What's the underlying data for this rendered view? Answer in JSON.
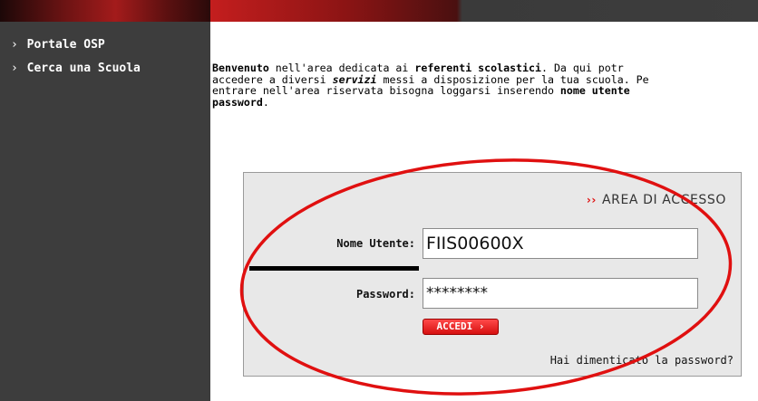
{
  "sidebar": {
    "items": [
      {
        "chevron": "›",
        "label": "Portale OSP"
      },
      {
        "chevron": "›",
        "label": "Cerca una Scuola"
      }
    ]
  },
  "intro": {
    "line1": {
      "w1": "Benvenuto",
      "t1": " nell'area dedicata ai ",
      "w2": "referenti scolastici",
      "t2": ". Da qui potr"
    },
    "line2": {
      "t1": "accedere a diversi ",
      "w1": "servizi",
      "t2": " messi a disposizione per la tua scuola. Pe"
    },
    "line3": {
      "t1": "entrare nell'area riservata bisogna loggarsi inserendo ",
      "w1": "nome utente"
    },
    "line4": {
      "w1": "password",
      "t1": "."
    }
  },
  "login": {
    "arrows": "››",
    "title": "AREA DI ACCESSO",
    "username_label": "Nome Utente:",
    "username_value": "FIIS00600X",
    "password_label": "Password:",
    "password_value": "********",
    "submit_label": "ACCEDI",
    "submit_chevron": "›",
    "forgot_link": "Hai dimenticato la password?"
  },
  "colors": {
    "annotation_ellipse": "#e01010",
    "sidebar_bg": "#3d3d3d",
    "button": "#e01010"
  }
}
